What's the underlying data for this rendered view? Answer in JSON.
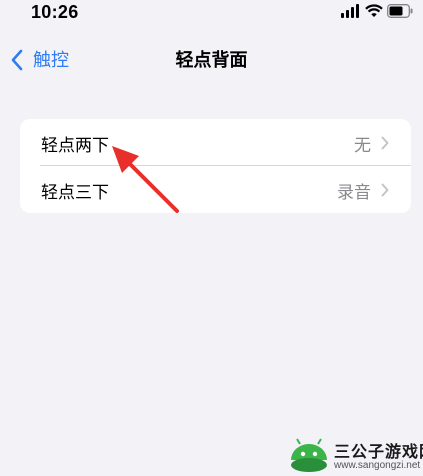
{
  "status_bar": {
    "time": "10:26",
    "icons": [
      "signal-icon",
      "wifi-icon",
      "battery-icon"
    ]
  },
  "nav": {
    "back_label": "触控",
    "title": "轻点背面"
  },
  "settings": [
    {
      "label": "轻点两下",
      "value": "无"
    },
    {
      "label": "轻点三下",
      "value": "录音"
    }
  ],
  "colors": {
    "accent": "#2f7cf6",
    "background": "#f2f2f7",
    "annotation_arrow": "#e8302a",
    "watermark_green": "#3bb54a"
  },
  "watermark": {
    "text": "三公子游戏网",
    "url": "www.sangongzi.net"
  }
}
